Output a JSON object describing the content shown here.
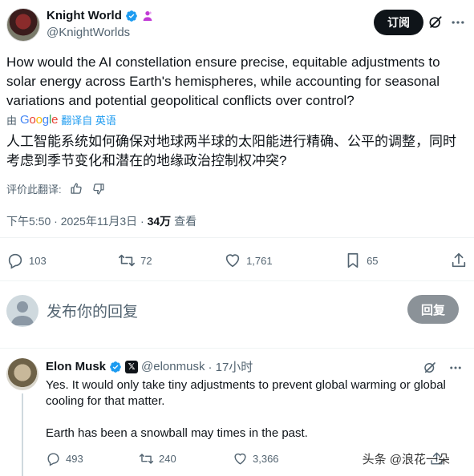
{
  "author": {
    "name": "Knight World",
    "handle": "@KnightWorlds",
    "subscribe_label": "订阅"
  },
  "tweet": {
    "text": "How would the AI constellation ensure precise, equitable adjustments to solar energy across Earth's hemispheres, while accounting for seasonal variations and potential geopolitical conflicts over control?",
    "translated_by_prefix": "由",
    "google_letters": [
      "G",
      "o",
      "o",
      "g",
      "l",
      "e"
    ],
    "translated_from": "翻译自 英语",
    "translated_text": "人工智能系统如何确保对地球两半球的太阳能进行精确、公平的调整，同时考虑到季节变化和潜在的地缘政治控制权冲突?",
    "rate_label": "评价此翻译:",
    "time": "下午5:50 · 2025年11月3日 · ",
    "views_count": "34万",
    "views_label": " 查看"
  },
  "stats": {
    "replies": "103",
    "reposts": "72",
    "likes": "1,761",
    "bookmarks": "65"
  },
  "composer": {
    "placeholder": "发布你的回复",
    "reply_button": "回复"
  },
  "reply": {
    "name": "Elon Musk",
    "handle": "@elonmusk",
    "time": "· 17小时",
    "paragraph1": "Yes. It would only take tiny adjustments to prevent global warming or global cooling for that matter.",
    "paragraph2": "Earth has been a snowball may times in the past.",
    "replies": "493",
    "reposts": "240",
    "likes": "3,366"
  },
  "watermark": "头条 @浪花一朵",
  "colors": {
    "verified_blue": "#1d9bf0",
    "text": "#0f1419",
    "muted": "#536471",
    "divider": "#eff3f4"
  }
}
